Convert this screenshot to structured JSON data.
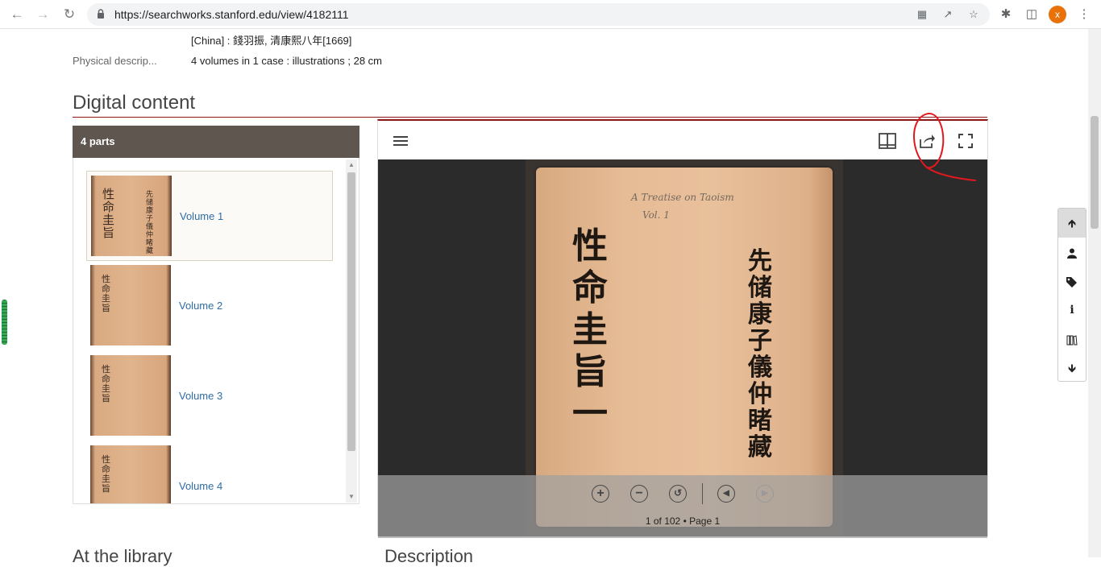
{
  "browser": {
    "url": "https://searchworks.stanford.edu/view/4182111",
    "profile_initial": "x"
  },
  "record": {
    "publication": "[China] : 錢羽振, 清康熙八年[1669]",
    "physical_label": "Physical descrip...",
    "physical_value": "4 volumes in 1 case : illustrations ; 28 cm"
  },
  "digital": {
    "title": "Digital content",
    "parts_header": "4 parts",
    "parts": [
      {
        "label": "Volume 1"
      },
      {
        "label": "Volume 2"
      },
      {
        "label": "Volume 3"
      },
      {
        "label": "Volume 4"
      }
    ],
    "page_label": "1 of 102 • Page 1",
    "cover_text_left": "性命圭旨 一",
    "cover_text_right": "先储康子儀仲睹藏",
    "pencil_note": "A Treatise on Taoism",
    "pencil_vol": "Vol. 1"
  },
  "bottom": {
    "left_heading": "At the library",
    "right_heading": "Description"
  },
  "colors": {
    "accent": "#8c1515",
    "link": "#2e6da4",
    "annotation": "#e0191f"
  },
  "icons": {
    "viewer_toolbar": [
      "menu-icon",
      "book-view-icon",
      "share-icon",
      "fullscreen-icon"
    ],
    "viewer_controls": [
      "zoom-in-icon",
      "zoom-out-icon",
      "reset-zoom-icon",
      "previous-icon",
      "next-icon"
    ],
    "float_nav": [
      "arrow-up-icon",
      "user-icon",
      "tags-icon",
      "info-icon",
      "library-icon",
      "arrow-down-icon"
    ]
  }
}
